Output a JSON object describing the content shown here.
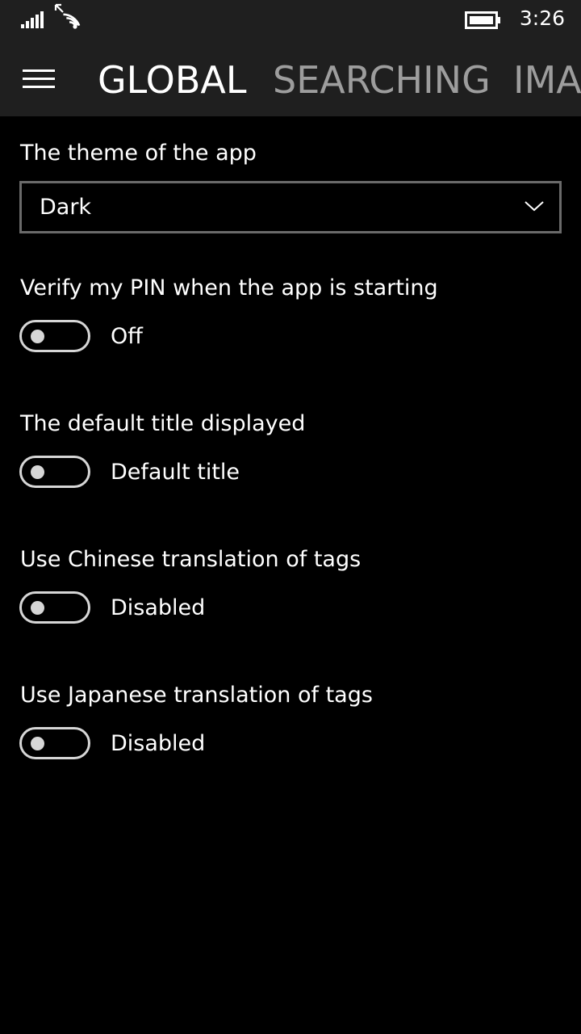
{
  "status_bar": {
    "time": "3:26",
    "icons": [
      "signal-icon",
      "wifi-icon",
      "battery-icon"
    ]
  },
  "header": {
    "menu_icon": "hamburger-menu-icon",
    "tabs": [
      {
        "label": "GLOBAL",
        "active": true
      },
      {
        "label": "SEARCHING",
        "active": false
      },
      {
        "label": "IMA",
        "active": false
      }
    ]
  },
  "settings": {
    "theme": {
      "label": "The theme of the app",
      "value": "Dark",
      "icon": "chevron-down-icon"
    },
    "toggles": [
      {
        "label": "Verify my PIN when the app is starting",
        "state": "Off",
        "on": false
      },
      {
        "label": "The default title displayed",
        "state": "Default title",
        "on": false
      },
      {
        "label": "Use Chinese translation of tags",
        "state": "Disabled",
        "on": false
      },
      {
        "label": "Use Japanese translation of tags",
        "state": "Disabled",
        "on": false
      }
    ]
  },
  "colors": {
    "background": "#000000",
    "chrome": "#1f1f1f",
    "text": "#ffffff",
    "inactive_tab": "#9d9d9d",
    "toggle": "#d6d6d6",
    "combo_border": "#6a6a6a"
  }
}
